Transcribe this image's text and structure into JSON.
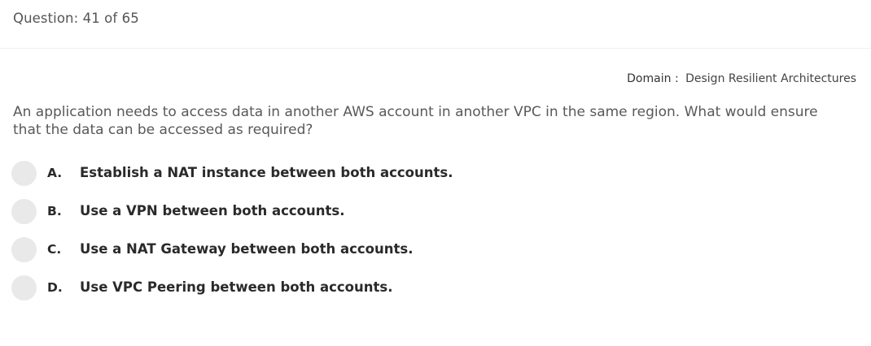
{
  "header": {
    "question_counter": "Question: 41 of 65"
  },
  "domain": {
    "label": "Domain",
    "separator": ":",
    "value": "Design Resilient Architectures"
  },
  "question": {
    "text": "An application needs to access data in another AWS account in another VPC in the same region. What would ensure that the data can be accessed as required?"
  },
  "options": [
    {
      "letter": "A.",
      "text": "Establish a NAT instance between both accounts."
    },
    {
      "letter": "B.",
      "text": "Use a VPN between both accounts."
    },
    {
      "letter": "C.",
      "text": "Use a NAT Gateway between both accounts."
    },
    {
      "letter": "D.",
      "text": "Use VPC Peering between both accounts."
    }
  ]
}
